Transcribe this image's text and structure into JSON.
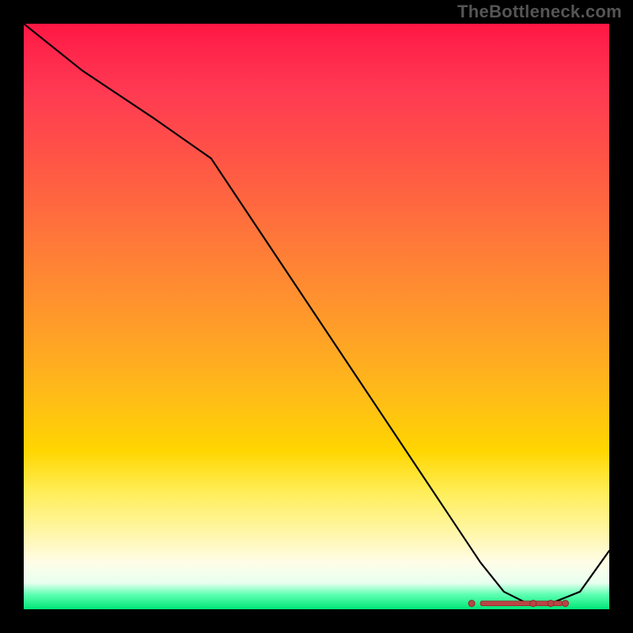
{
  "watermark": "TheBottleneck.com",
  "colors": {
    "top": "#ff1744",
    "mid": "#ffd600",
    "bottom": "#00e676",
    "line": "#000000",
    "dots": "#b94545"
  },
  "chart_data": {
    "type": "line",
    "title": "",
    "xlabel": "",
    "ylabel": "",
    "xlim": [
      0,
      100
    ],
    "ylim": [
      0,
      100
    ],
    "x": [
      0,
      10,
      22,
      32,
      40,
      48,
      56,
      64,
      72,
      78,
      82,
      86,
      90,
      95,
      100
    ],
    "values": [
      100,
      92,
      84,
      77,
      65,
      53,
      41,
      29,
      17,
      8,
      3,
      1,
      1,
      3,
      10
    ],
    "marker_region": {
      "x_start": 78,
      "x_end": 92,
      "y": 1
    }
  }
}
